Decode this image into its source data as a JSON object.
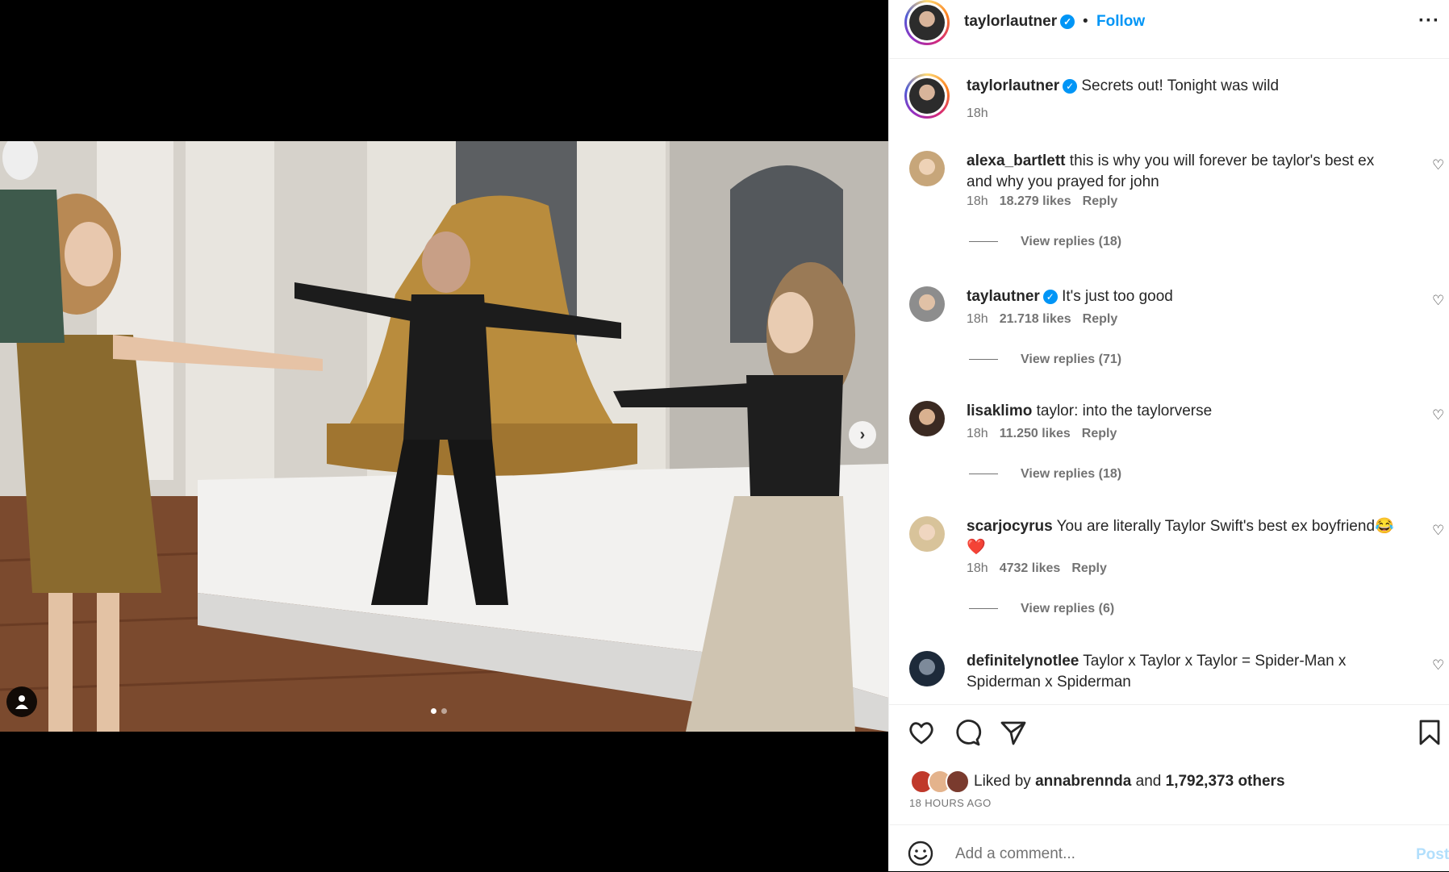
{
  "header": {
    "username": "taylorlautner",
    "dot": "•",
    "follow_label": "Follow",
    "more_label": "···"
  },
  "caption": {
    "username": "taylorlautner",
    "text": "Secrets out! Tonight was wild",
    "time": "18h"
  },
  "comments": [
    {
      "username": "alexa_bartlett",
      "text": "this is why you will forever be taylor's best ex and why you prayed for john",
      "time": "18h",
      "likes": "18.279 likes",
      "reply_label": "Reply",
      "view_replies": "View replies (18)",
      "verified": false
    },
    {
      "username": "taylautner",
      "text": "It's just too good",
      "time": "18h",
      "likes": "21.718 likes",
      "reply_label": "Reply",
      "view_replies": "View replies (71)",
      "verified": true
    },
    {
      "username": "lisaklimo",
      "text": "taylor: into the taylorverse",
      "time": "18h",
      "likes": "11.250 likes",
      "reply_label": "Reply",
      "view_replies": "View replies (18)",
      "verified": false
    },
    {
      "username": "scarjocyrus",
      "text": "You are literally Taylor Swift's best ex boyfriend😂❤️",
      "time": "18h",
      "likes": "4732 likes",
      "reply_label": "Reply",
      "view_replies": "View replies (6)",
      "verified": false
    },
    {
      "username": "definitelynotlee",
      "text": "Taylor x Taylor x Taylor = Spider-Man x Spiderman x Spiderman",
      "verified": false
    }
  ],
  "actions": {
    "like_icon": "heart-icon",
    "comment_icon": "comment-icon",
    "share_icon": "send-icon",
    "save_icon": "bookmark-icon"
  },
  "likes_summary": {
    "prefix": "Liked by",
    "user": "annabrennda",
    "and": "and",
    "others": "1,792,373 others"
  },
  "time_ago": "18 HOURS AGO",
  "add_comment": {
    "placeholder": "Add a comment...",
    "post_label": "Post"
  },
  "media": {
    "carousel_total": 2,
    "carousel_active": 1,
    "next_icon": "chevron-right-icon",
    "tag_icon": "user-tag-icon"
  },
  "colors": {
    "accent": "#0095f6",
    "text": "#262626",
    "secondary": "#737373",
    "post_disabled": "#b2dffc"
  }
}
